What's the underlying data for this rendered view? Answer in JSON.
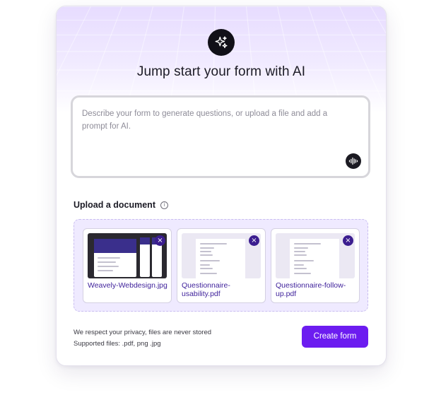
{
  "header": {
    "title": "Jump start your form with AI",
    "icon": "sparkle-icon"
  },
  "prompt": {
    "placeholder": "Describe your form to generate questions, or upload a file and add a prompt for AI.",
    "voice_icon": "soundwave-icon"
  },
  "upload": {
    "heading": "Upload a document",
    "info_icon": "info-icon",
    "info_glyph": "i",
    "files": [
      {
        "name": "Weavely-Webdesign.jpg",
        "kind": "image"
      },
      {
        "name": "Questionnaire-usability.pdf",
        "kind": "pdf"
      },
      {
        "name": "Questionnaire-follow-up.pdf",
        "kind": "pdf"
      }
    ],
    "remove_glyph": "×"
  },
  "footer": {
    "privacy_note": "We respect your privacy, files are never stored",
    "supported_files": "Supported files: .pdf, png .jpg",
    "create_button": "Create form"
  },
  "colors": {
    "accent": "#6c1cf0",
    "file_name": "#3d1f9a",
    "remove_button": "#3b1d8f",
    "dropzone_bg": "#efeaff"
  }
}
